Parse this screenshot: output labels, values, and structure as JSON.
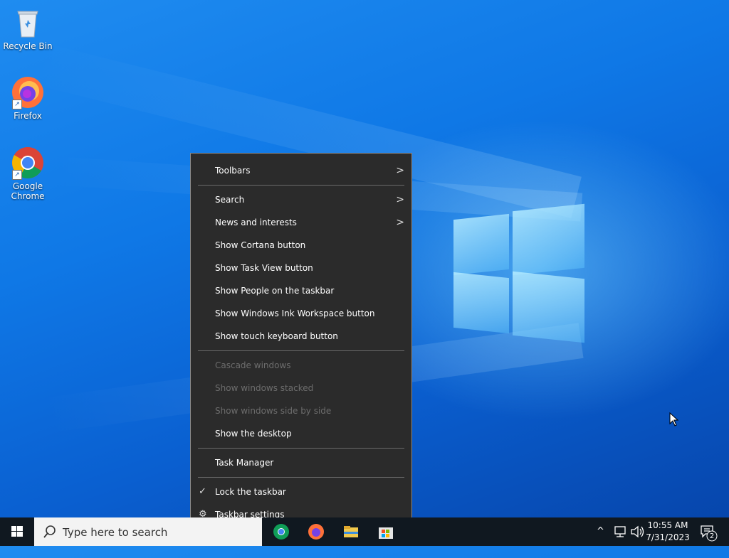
{
  "desktop": {
    "icons": [
      {
        "label": "Recycle Bin",
        "icon": "recycle-bin-icon"
      },
      {
        "label": "Firefox",
        "icon": "firefox-icon"
      },
      {
        "label": "Google Chrome",
        "icon": "chrome-icon"
      }
    ]
  },
  "context_menu": {
    "items": [
      {
        "label": "Toolbars",
        "submenu": true,
        "enabled": true
      },
      {
        "label": "Search",
        "submenu": true,
        "enabled": true
      },
      {
        "label": "News and interests",
        "submenu": true,
        "enabled": true
      },
      {
        "label": "Show Cortana button",
        "enabled": true
      },
      {
        "label": "Show Task View button",
        "enabled": true
      },
      {
        "label": "Show People on the taskbar",
        "enabled": true
      },
      {
        "label": "Show Windows Ink Workspace button",
        "enabled": true
      },
      {
        "label": "Show touch keyboard button",
        "enabled": true
      },
      {
        "label": "Cascade windows",
        "enabled": false
      },
      {
        "label": "Show windows stacked",
        "enabled": false
      },
      {
        "label": "Show windows side by side",
        "enabled": false
      },
      {
        "label": "Show the desktop",
        "enabled": true
      },
      {
        "label": "Task Manager",
        "enabled": true
      },
      {
        "label": "Lock the taskbar",
        "checked": true,
        "enabled": true
      },
      {
        "label": "Taskbar settings",
        "icon": "gear-icon",
        "enabled": true
      }
    ]
  },
  "taskbar": {
    "search_placeholder": "Type here to search",
    "pinned": [
      "chrome-icon",
      "firefox-icon",
      "file-explorer-icon",
      "store-icon"
    ],
    "clock_time": "10:55 AM",
    "clock_date": "7/31/2023",
    "notification_count": "2"
  },
  "colors": {
    "menu_bg": "#2b2b2b",
    "taskbar_bg": "#101820",
    "disabled_text": "#6d6d6d"
  }
}
